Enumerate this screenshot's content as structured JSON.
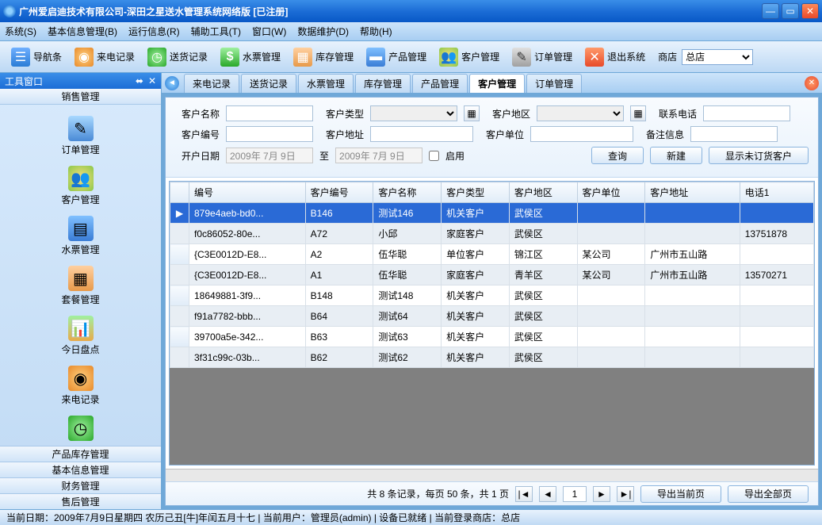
{
  "window": {
    "title": "广州爱启迪技术有限公司-深田之星送水管理系统网络版  [已注册]"
  },
  "menu": [
    "系统(S)",
    "基本信息管理(B)",
    "运行信息(R)",
    "辅助工具(T)",
    "窗口(W)",
    "数据维护(D)",
    "帮助(H)"
  ],
  "toolbar": {
    "nav": "导航条",
    "call": "来电记录",
    "delivery": "送货记录",
    "ticket": "水票管理",
    "stock": "库存管理",
    "product": "产品管理",
    "customer": "客户管理",
    "order": "订单管理",
    "exit": "退出系统",
    "storeLabel": "商店",
    "storeValue": "总店"
  },
  "sidebar": {
    "title": "工具窗口",
    "saleSection": "销售管理",
    "items": [
      {
        "label": "订单管理"
      },
      {
        "label": "客户管理"
      },
      {
        "label": "水票管理"
      },
      {
        "label": "套餐管理"
      },
      {
        "label": "今日盘点"
      },
      {
        "label": "来电记录"
      }
    ],
    "sections": [
      "产品库存管理",
      "基本信息管理",
      "财务管理",
      "售后管理"
    ]
  },
  "tabs": [
    "来电记录",
    "送货记录",
    "水票管理",
    "库存管理",
    "产品管理",
    "客户管理",
    "订单管理"
  ],
  "activeTab": "客户管理",
  "search": {
    "name": "客户名称",
    "type": "客户类型",
    "region": "客户地区",
    "phone": "联系电话",
    "code": "客户编号",
    "address": "客户地址",
    "unit": "客户单位",
    "remark": "备注信息",
    "openDate": "开户日期",
    "date1": "2009年 7月 9日",
    "to": "至",
    "date2": "2009年 7月 9日",
    "enable": "启用",
    "query": "查询",
    "new": "新建",
    "showUnordered": "显示未订货客户"
  },
  "table": {
    "headers": [
      "编号",
      "客户编号",
      "客户名称",
      "客户类型",
      "客户地区",
      "客户单位",
      "客户地址",
      "电话1"
    ],
    "rows": [
      {
        "id": "879e4aeb-bd0...",
        "code": "B146",
        "name": "测试146",
        "type": "机关客户",
        "region": "武侯区",
        "unit": "",
        "addr": "",
        "phone": ""
      },
      {
        "id": "f0c86052-80e...",
        "code": "A72",
        "name": "小邱",
        "type": "家庭客户",
        "region": "武侯区",
        "unit": "",
        "addr": "",
        "phone": "13751878"
      },
      {
        "id": "{C3E0012D-E8...",
        "code": "A2",
        "name": "伍华聪",
        "type": "单位客户",
        "region": "锦江区",
        "unit": "某公司",
        "addr": "广州市五山路",
        "phone": ""
      },
      {
        "id": "{C3E0012D-E8...",
        "code": "A1",
        "name": "伍华聪",
        "type": "家庭客户",
        "region": "青羊区",
        "unit": "某公司",
        "addr": "广州市五山路",
        "phone": "13570271"
      },
      {
        "id": "18649881-3f9...",
        "code": "B148",
        "name": "测试148",
        "type": "机关客户",
        "region": "武侯区",
        "unit": "",
        "addr": "",
        "phone": ""
      },
      {
        "id": "f91a7782-bbb...",
        "code": "B64",
        "name": "测试64",
        "type": "机关客户",
        "region": "武侯区",
        "unit": "",
        "addr": "",
        "phone": ""
      },
      {
        "id": "39700a5e-342...",
        "code": "B63",
        "name": "测试63",
        "type": "机关客户",
        "region": "武侯区",
        "unit": "",
        "addr": "",
        "phone": ""
      },
      {
        "id": "3f31c99c-03b...",
        "code": "B62",
        "name": "测试62",
        "type": "机关客户",
        "region": "武侯区",
        "unit": "",
        "addr": "",
        "phone": ""
      }
    ]
  },
  "pager": {
    "summary": "共 8 条记录，每页 50 条，共 1 页",
    "page": "1",
    "exportCurrent": "导出当前页",
    "exportAll": "导出全部页"
  },
  "status": "当前日期：2009年7月9日星期四 农历己丑[牛]年闰五月十七 | 当前用户：管理员(admin) | 设备已就绪 | 当前登录商店：总店"
}
